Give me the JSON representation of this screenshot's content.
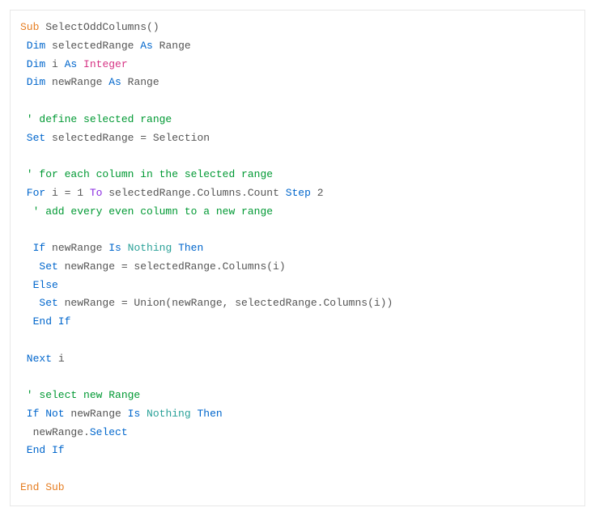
{
  "code": {
    "line1_sub": "Sub",
    "line1_name": " SelectOddColumns()",
    "line2_dim": " Dim",
    "line2_var": " selectedRange ",
    "line2_as": "As",
    "line2_type": " Range",
    "line3_dim": " Dim",
    "line3_var": " i ",
    "line3_as": "As",
    "line3_type": " Integer",
    "line4_dim": " Dim",
    "line4_var": " newRange ",
    "line4_as": "As",
    "line4_type": " Range",
    "comment1": " ' define selected range",
    "line5_set": " Set",
    "line5_rest": " selectedRange = Selection",
    "comment2": " ' for each column in the selected range",
    "line6_for": " For",
    "line6_mid1": " i = ",
    "line6_num1": "1",
    "line6_to": " To",
    "line6_mid2": " selectedRange.Columns.Count ",
    "line6_step": "Step",
    "line6_num2": " 2",
    "comment3": "  ' add every even column to a new range",
    "line7_if": "  If",
    "line7_mid1": " newRange ",
    "line7_is": "Is",
    "line7_nothing": " Nothing ",
    "line7_then": "Then",
    "line8_set": "   Set",
    "line8_rest": " newRange = selectedRange.Columns(i)",
    "line9_else": "  Else",
    "line10_set": "   Set",
    "line10_rest": " newRange = Union(newRange, selectedRange.Columns(i))",
    "line11_endif": "  End If",
    "line12_next": " Next",
    "line12_var": " i",
    "comment4": " ' select new Range",
    "line13_if": " If",
    "line13_not": " Not",
    "line13_mid1": " newRange ",
    "line13_is": "Is",
    "line13_nothing": " Nothing ",
    "line13_then": "Then",
    "line14_rest": "  newRange.",
    "line14_select": "Select",
    "line15_endif": " End If",
    "line16_endsub": "End Sub"
  }
}
